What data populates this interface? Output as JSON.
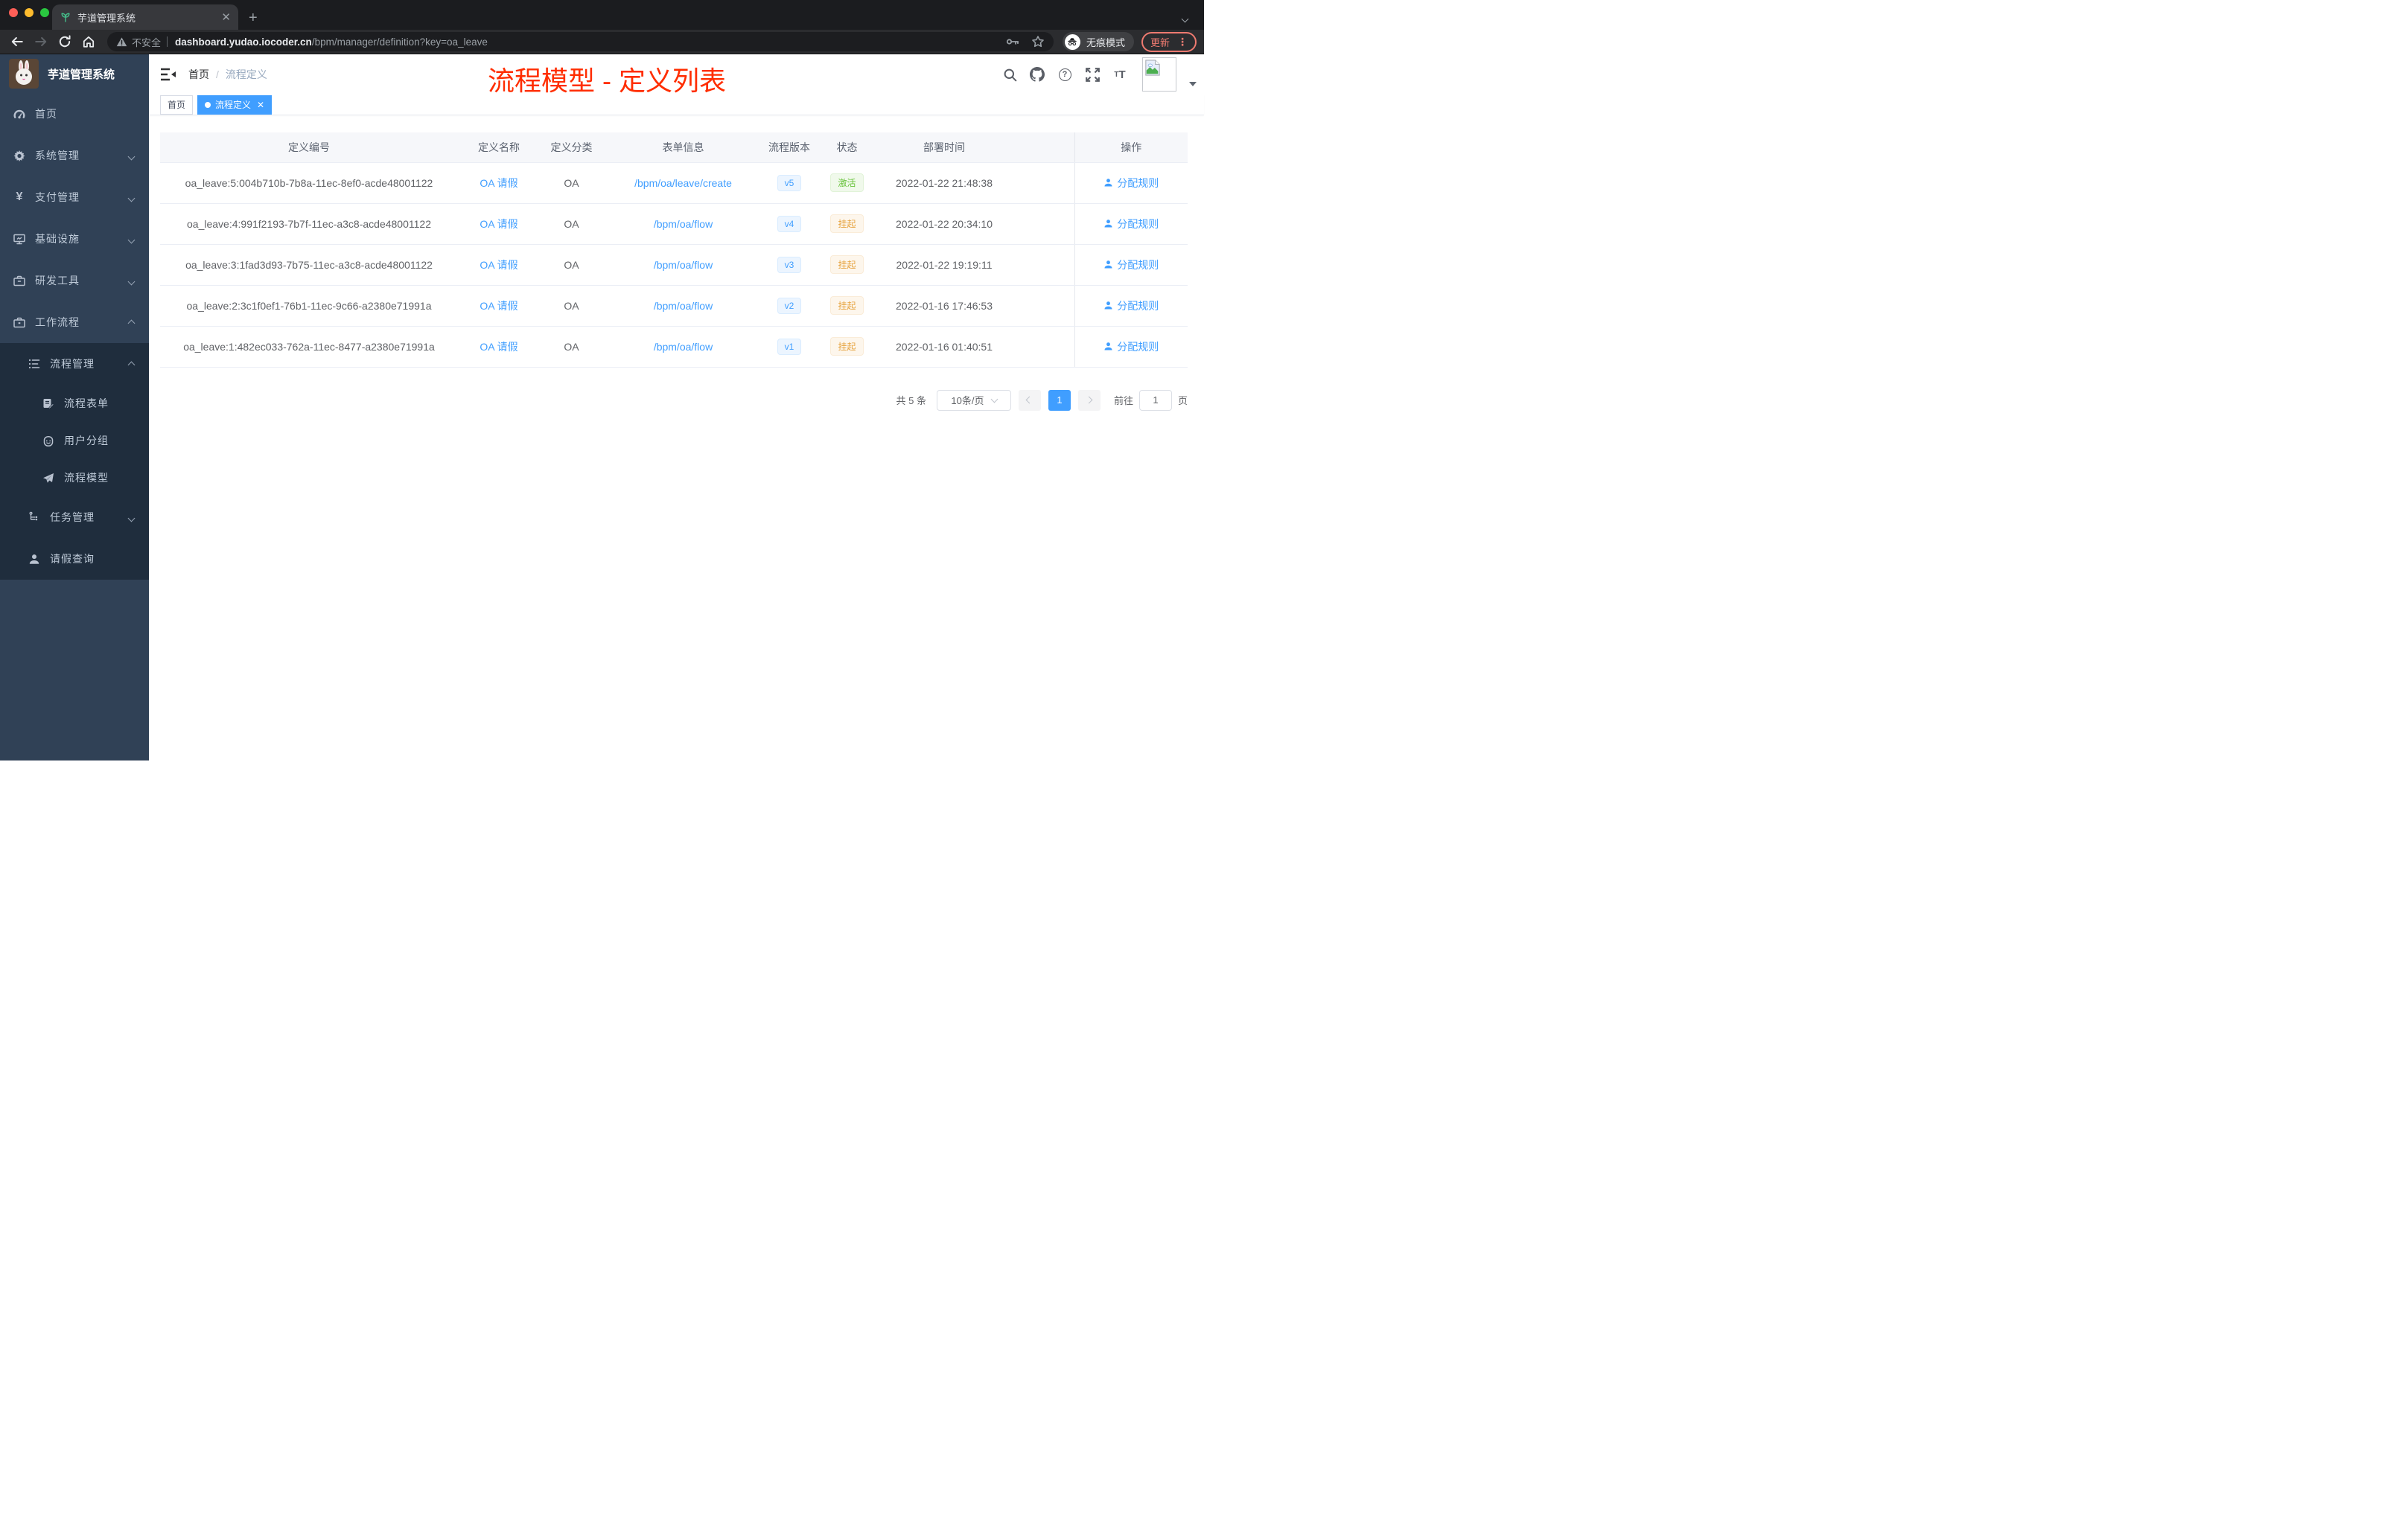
{
  "browser": {
    "tab_title": "芋道管理系统",
    "security_label": "不安全",
    "url_domain": "dashboard.yudao.iocoder.cn",
    "url_path": "/bpm/manager/definition?key=oa_leave",
    "incognito_label": "无痕模式",
    "update_label": "更新"
  },
  "sidebar": {
    "app_title": "芋道管理系统",
    "items": [
      {
        "label": "首页"
      },
      {
        "label": "系统管理"
      },
      {
        "label": "支付管理"
      },
      {
        "label": "基础设施"
      },
      {
        "label": "研发工具"
      },
      {
        "label": "工作流程"
      },
      {
        "label": "流程管理"
      },
      {
        "label": "流程表单"
      },
      {
        "label": "用户分组"
      },
      {
        "label": "流程模型"
      },
      {
        "label": "任务管理"
      },
      {
        "label": "请假查询"
      }
    ]
  },
  "header": {
    "breadcrumb_home": "首页",
    "breadcrumb_current": "流程定义",
    "annotation": "流程模型 - 定义列表"
  },
  "tags": {
    "home": "首页",
    "active": "流程定义"
  },
  "table": {
    "columns": [
      "定义编号",
      "定义名称",
      "定义分类",
      "表单信息",
      "流程版本",
      "状态",
      "部署时间",
      "操作"
    ],
    "rows": [
      {
        "id": "oa_leave:5:004b710b-7b8a-11ec-8ef0-acde48001122",
        "name": "OA 请假",
        "category": "OA",
        "form": "/bpm/oa/leave/create",
        "version": "v5",
        "status": "激活",
        "time": "2022-01-22 21:48:38",
        "action": "分配规则"
      },
      {
        "id": "oa_leave:4:991f2193-7b7f-11ec-a3c8-acde48001122",
        "name": "OA 请假",
        "category": "OA",
        "form": "/bpm/oa/flow",
        "version": "v4",
        "status": "挂起",
        "time": "2022-01-22 20:34:10",
        "action": "分配规则"
      },
      {
        "id": "oa_leave:3:1fad3d93-7b75-11ec-a3c8-acde48001122",
        "name": "OA 请假",
        "category": "OA",
        "form": "/bpm/oa/flow",
        "version": "v3",
        "status": "挂起",
        "time": "2022-01-22 19:19:11",
        "action": "分配规则"
      },
      {
        "id": "oa_leave:2:3c1f0ef1-76b1-11ec-9c66-a2380e71991a",
        "name": "OA 请假",
        "category": "OA",
        "form": "/bpm/oa/flow",
        "version": "v2",
        "status": "挂起",
        "time": "2022-01-16 17:46:53",
        "action": "分配规则"
      },
      {
        "id": "oa_leave:1:482ec033-762a-11ec-8477-a2380e71991a",
        "name": "OA 请假",
        "category": "OA",
        "form": "/bpm/oa/flow",
        "version": "v1",
        "status": "挂起",
        "time": "2022-01-16 01:40:51",
        "action": "分配规则"
      }
    ]
  },
  "pagination": {
    "total_label": "共 5 条",
    "page_size": "10条/页",
    "page": "1",
    "goto_label": "前往",
    "goto_value": "1",
    "unit_label": "页"
  },
  "colors": {
    "accent": "#409eff",
    "annotation_red": "#ff2d00",
    "success_green": "#67c23a",
    "warning_orange": "#e6a23c",
    "sidebar_bg": "#304156",
    "submenu_bg": "#1f2d3d",
    "update_coral": "#ee7a70"
  }
}
